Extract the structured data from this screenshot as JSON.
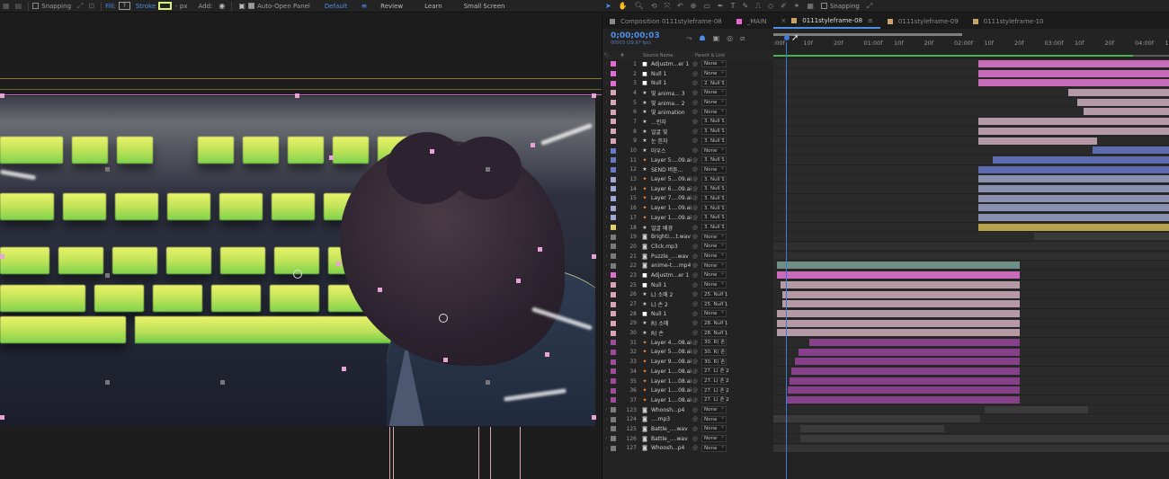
{
  "toolbar": {
    "snapping_label": "Snapping",
    "fill_label": "Fill:",
    "fill_value": "?",
    "stroke_label": "Stroke",
    "stroke_unit": "- px",
    "add_label": "Add:",
    "auto_open_label": "Auto-Open Panel",
    "workspaces": [
      "Default",
      "Review",
      "Learn",
      "Small Screen"
    ],
    "active_workspace": "Default",
    "stroke_color": "#d8f27a",
    "accent": "#4d8fe8"
  },
  "toolbar_right": {
    "snapping_label": "Snapping"
  },
  "timeline": {
    "tabs": [
      {
        "label": "Composition 0111styleframe-08",
        "color": "#8a8a8a",
        "active": false,
        "closable": false
      },
      {
        "label": "_MAIN",
        "color": "#e36bd3",
        "active": false,
        "closable": false
      },
      {
        "label": "0111styleframe-08",
        "color": "#c9a368",
        "active": true,
        "closable": true
      },
      {
        "label": "0111styleframe-09",
        "color": "#c9a368",
        "active": false,
        "closable": false
      },
      {
        "label": "0111styleframe-10",
        "color": "#c9a368",
        "active": false,
        "closable": false
      }
    ],
    "timecode": "0;00;00;03",
    "frames_readout": "00003 (29.97 fps)",
    "columns": {
      "source_name": "Source Name",
      "parent_link": "Parent & Link"
    },
    "ruler_ticks": [
      ":00f",
      "10f",
      "20f",
      "01:00f",
      "10f",
      "20f",
      "02:00f",
      "10f",
      "20f",
      "03:00f",
      "10f",
      "20f",
      "04:00f",
      "10f"
    ],
    "layers": [
      {
        "num": "1",
        "name": "Adjustm...er 1",
        "type": "solid",
        "label": "#e36bd3",
        "parent": "None"
      },
      {
        "num": "2",
        "name": "Null 1",
        "type": "solid",
        "label": "#e36bd3",
        "parent": "None"
      },
      {
        "num": "3",
        "name": "Null 1",
        "type": "solid",
        "label": "#e36bd3",
        "parent": "2. Null 1"
      },
      {
        "num": "4",
        "name": "빛 anima... 3",
        "type": "star",
        "label": "#d9a3b8",
        "parent": "None"
      },
      {
        "num": "5",
        "name": "빛 anima... 2",
        "type": "star",
        "label": "#d9a3b8",
        "parent": "None"
      },
      {
        "num": "6",
        "name": "빛 animation",
        "type": "star",
        "label": "#d9a3b8",
        "parent": "None"
      },
      {
        "num": "7",
        "name": "...린자",
        "type": "star",
        "label": "#d9a3b8",
        "parent": "3. Null 1"
      },
      {
        "num": "8",
        "name": "얼굴 빛",
        "type": "star",
        "label": "#d9a3b8",
        "parent": "3. Null 1"
      },
      {
        "num": "9",
        "name": "눈 흰자",
        "type": "star",
        "label": "#d9a3b8",
        "parent": "3. Null 1"
      },
      {
        "num": "10",
        "name": "마우스",
        "type": "star",
        "label": "#6a78c8",
        "parent": "None"
      },
      {
        "num": "11",
        "name": "Layer 5....09.ai",
        "type": "ai",
        "label": "#6a78c8",
        "parent": "3. Null 1"
      },
      {
        "num": "12",
        "name": "SEND 버튼...",
        "type": "star",
        "label": "#6a78c8",
        "parent": "None"
      },
      {
        "num": "13",
        "name": "Layer 5....09.ai",
        "type": "ai",
        "label": "#a0a8d8",
        "parent": "3. Null 1"
      },
      {
        "num": "14",
        "name": "Layer 6....09.ai",
        "type": "ai",
        "label": "#a0a8d8",
        "parent": "3. Null 1"
      },
      {
        "num": "15",
        "name": "Layer 7....09.ai",
        "type": "ai",
        "label": "#a0a8d8",
        "parent": "3. Null 1"
      },
      {
        "num": "16",
        "name": "Layer 1....09.ai",
        "type": "ai",
        "label": "#a0a8d8",
        "parent": "3. Null 1"
      },
      {
        "num": "17",
        "name": "Layer 1....09.ai",
        "type": "ai",
        "label": "#a0a8d8",
        "parent": "3. Null 1"
      },
      {
        "num": "18",
        "name": "얼굴 배경",
        "type": "star",
        "label": "#e3d06a",
        "parent": "3. Null 1"
      },
      {
        "num": "19",
        "name": "Brighti....t.wav",
        "type": "audio",
        "label": "#7a7a7a",
        "parent": "None"
      },
      {
        "num": "20",
        "name": "Click.mp3",
        "type": "audio",
        "label": "#7a7a7a",
        "parent": "None"
      },
      {
        "num": "21",
        "name": "Puzzle_....wav",
        "type": "audio",
        "label": "#7a7a7a",
        "parent": "None"
      },
      {
        "num": "22",
        "name": "anime-t....mp4",
        "type": "audio",
        "label": "#7a7a7a",
        "parent": "None"
      },
      {
        "num": "23",
        "name": "Adjustm...er 1",
        "type": "solid",
        "label": "#e36bd3",
        "parent": "None"
      },
      {
        "num": "25",
        "name": "Null 1",
        "type": "solid",
        "label": "#d9a3b8",
        "parent": "None"
      },
      {
        "num": "26",
        "name": "L) 소매 2",
        "type": "star",
        "label": "#d9a3b8",
        "parent": "25. Null 1"
      },
      {
        "num": "27",
        "name": "L) 손 2",
        "type": "star",
        "label": "#d9a3b8",
        "parent": "25. Null 1"
      },
      {
        "num": "28",
        "name": "Null 1",
        "type": "solid",
        "label": "#d9a3b8",
        "parent": "None"
      },
      {
        "num": "29",
        "name": "R) 소매",
        "type": "star",
        "label": "#d9a3b8",
        "parent": "28. Null 1"
      },
      {
        "num": "30",
        "name": "R) 손",
        "type": "star",
        "label": "#d9a3b8",
        "parent": "28. Null 1"
      },
      {
        "num": "31",
        "name": "Layer 4....08.ai",
        "type": "ai",
        "label": "#a04a9e",
        "parent": "30. R) 손"
      },
      {
        "num": "32",
        "name": "Layer 5....08.ai",
        "type": "ai",
        "label": "#a04a9e",
        "parent": "30. R) 손"
      },
      {
        "num": "33",
        "name": "Layer 9....08.ai",
        "type": "ai",
        "label": "#a04a9e",
        "parent": "30. R) 손"
      },
      {
        "num": "34",
        "name": "Layer 1....08.ai",
        "type": "ai",
        "label": "#a04a9e",
        "parent": "27. L) 손 2"
      },
      {
        "num": "35",
        "name": "Layer 1....08.ai",
        "type": "ai",
        "label": "#a04a9e",
        "parent": "27. L) 손 2"
      },
      {
        "num": "36",
        "name": "Layer 1....08.ai",
        "type": "ai",
        "label": "#a04a9e",
        "parent": "27. L) 손 2"
      },
      {
        "num": "37",
        "name": "Layer 1....08.ai",
        "type": "ai",
        "label": "#a04a9e",
        "parent": "27. L) 손 2"
      },
      {
        "num": "123",
        "name": "Whoosh...p4",
        "type": "audio",
        "label": "#7a7a7a",
        "parent": "None"
      },
      {
        "num": "124",
        "name": "....mp3",
        "type": "audio",
        "label": "#7a7a7a",
        "parent": "None"
      },
      {
        "num": "125",
        "name": "Battle_....wav",
        "type": "audio",
        "label": "#7a7a7a",
        "parent": "None"
      },
      {
        "num": "126",
        "name": "Battle_....wav",
        "type": "audio",
        "label": "#7a7a7a",
        "parent": "None"
      },
      {
        "num": "127",
        "name": "Whoosh...p4",
        "type": "audio",
        "label": "#7a7a7a",
        "parent": "None"
      }
    ]
  }
}
